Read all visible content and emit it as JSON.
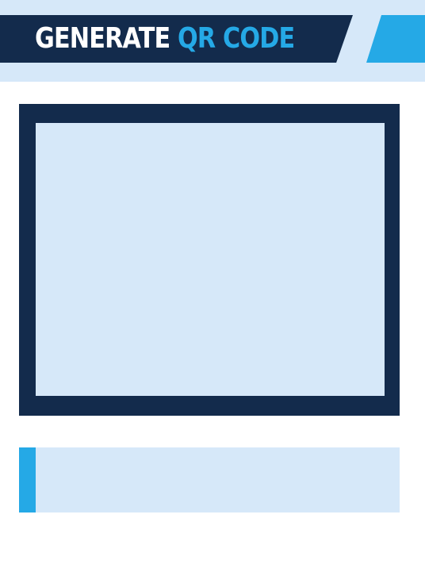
{
  "header": {
    "title_main": "GENERATE",
    "title_accent": "QR CODE"
  },
  "qr_display": {},
  "input": {
    "value": "",
    "placeholder": ""
  },
  "colors": {
    "navy": "#132b4c",
    "accent_blue": "#25a9e6",
    "light_blue": "#d6e8f9",
    "white": "#ffffff"
  }
}
